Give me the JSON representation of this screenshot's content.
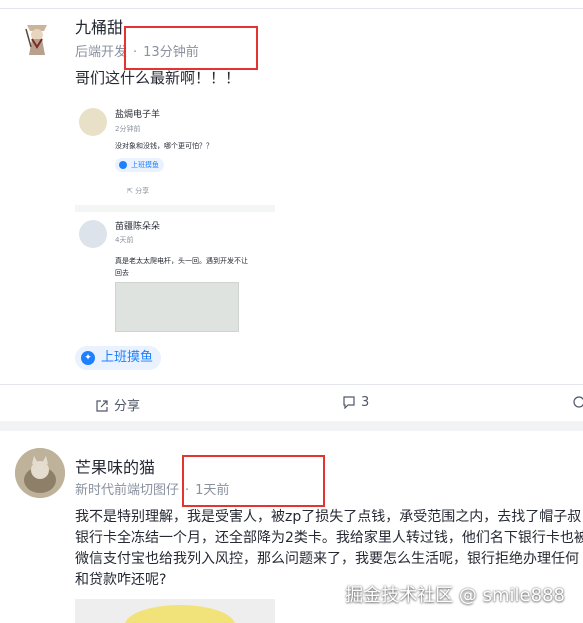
{
  "colors": {
    "accent": "#1e80ff",
    "highlight_box": "#e3342f"
  },
  "posts": [
    {
      "author": "九桶甜",
      "category": "后端开发",
      "time": "13分钟前",
      "body": "哥们这什么最新啊！！！",
      "tag": "上班摸鱼",
      "actions": {
        "share": "分享",
        "comments": "3"
      },
      "embedded": {
        "c1": {
          "author": "盐焗电子羊",
          "time": "2分钟前",
          "text": "没对象和没钱，哪个更可怕？？",
          "tag": "上班摸鱼",
          "share": "分享"
        },
        "c2": {
          "author": "苗疆陈朵朵",
          "time": "4天前",
          "text1": "真是老太太爬电杆，头一回。遇到开发不让",
          "text2": "回去"
        }
      }
    },
    {
      "author": "芒果味的猫",
      "category": "新时代前端切图仔",
      "time": "1天前",
      "body": [
        "我不是特别理解，我是受害人，被zp了损失了点钱，承受范围之内，去找了帽子叔",
        "银行卡全冻结一个月，还全部降为2类卡。我给家里人转过钱，他们名下银行卡也被",
        "微信支付宝也给我列入风控，那么问题来了，我要怎么生活呢，银行拒绝办理任何",
        "和贷款咋还呢?"
      ]
    }
  ],
  "watermark": "掘金技术社区 @ smile888"
}
